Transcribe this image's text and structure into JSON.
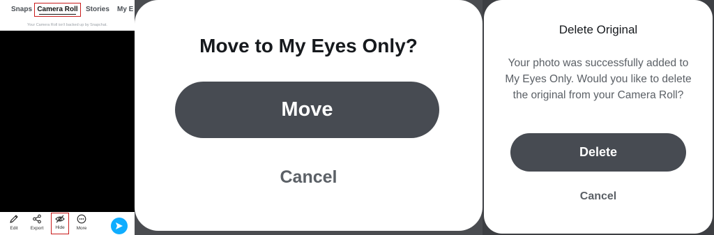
{
  "memories": {
    "tabs": [
      {
        "label": "Snaps"
      },
      {
        "label": "Camera Roll",
        "selected": true
      },
      {
        "label": "Stories"
      },
      {
        "label": "My E"
      }
    ],
    "backup_note": "Your Camera Roll isn't backed up by Snapchat.",
    "toolbar": {
      "edit_label": "Edit",
      "export_label": "Export",
      "hide_label": "Hide",
      "more_label": "More"
    },
    "highlight_color": "#c91c1c",
    "send_color": "#0fadff"
  },
  "move_dialog": {
    "title": "Move to My Eyes Only?",
    "move_label": "Move",
    "cancel_label": "Cancel"
  },
  "delete_dialog": {
    "title": "Delete Original",
    "body": "Your photo was successfully added to My Eyes Only. Would you like to delete the original from your Camera Roll?",
    "delete_label": "Delete",
    "cancel_label": "Cancel"
  },
  "icons": [
    "pencil-icon",
    "share-icon",
    "eye-slash-icon",
    "more-dots-icon",
    "send-arrow-icon"
  ]
}
